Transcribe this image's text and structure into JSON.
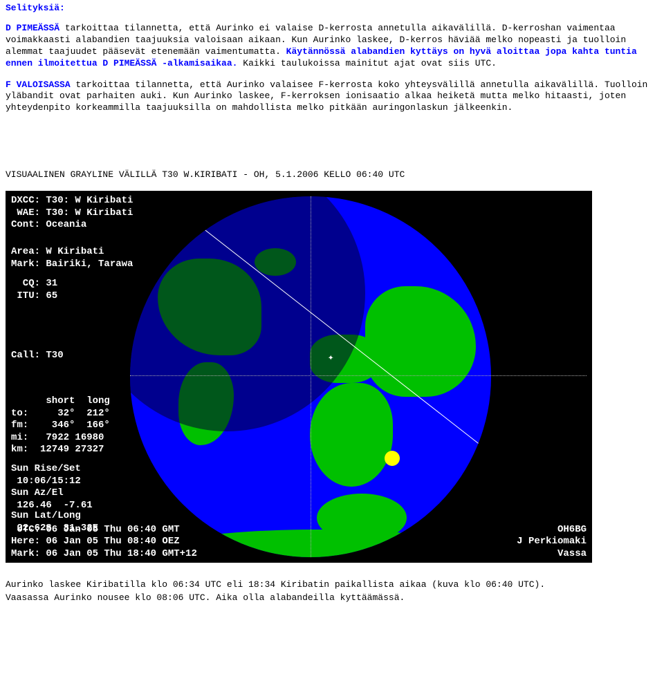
{
  "header": "Selityksiä:",
  "para1": {
    "lead": "D PIMEÄSSÄ",
    "text1": " tarkoittaa tilannetta, että Aurinko ei valaise D-kerrosta annetulla aikavälillä. D-kerroshan vaimentaa voimakkaasti alabandien taajuuksia valoisaan aikaan. Kun Aurinko laskee, D-kerros häviää melko nopeasti ja tuolloin alemmat taajuudet pääsevät etenemään vaimentumatta. ",
    "bold": "Käytännössä alabandien kyttäys on hyvä aloittaa jopa kahta tuntia ennen ilmoitettua D PIMEÄSSÄ -alkamisaikaa.",
    "text2": " Kaikki taulukoissa mainitut ajat ovat siis UTC."
  },
  "para2": {
    "lead": "F VALOISASSA",
    "text": " tarkoittaa tilannetta, että Aurinko valaisee F-kerrosta koko yhteysvälillä annetulla aikavälillä. Tuolloin yläbandit ovat parhaiten auki. Kun Aurinko laskee, F-kerroksen ionisaatio alkaa heiketä mutta melko hitaasti, joten yhteydenpito korkeammilla taajuuksilla on mahdollista melko pitkään auringonlaskun jälkeenkin."
  },
  "caption_above": "VISUAALINEN GRAYLINE VÄLILLÄ T30 W.KIRIBATI - OH, 5.1.2006 KELLO 06:40 UTC",
  "map": {
    "top": "DXCC: T30: W Kiribati\n WAE: T30: W Kiribati\nCont: Oceania",
    "area": "Area: W Kiribati\nMark: Bairiki, Tarawa",
    "cq": "  CQ: 31\n ITU: 65",
    "call": "Call: T30",
    "path": "      short  long\nto:     32°  212°\nfm:    346°  166°\nmi:   7922 16980\nkm:  12749 27327",
    "sun": "Sun Rise/Set\n 10:06/15:12\nSun Az/El\n 126.46  -7.61",
    "latlong": "Sun Lat/Long\n 22.62S  81.32E",
    "utc": " UTC: 06 Jan 05 Thu 06:40 GMT\nHere: 06 Jan 05 Thu 08:40 OEZ\nMark: 06 Jan 05 Thu 18:40 GMT+12",
    "right": "OH6BG\nJ Perkiomaki\nVassa"
  },
  "caption_below1": "Aurinko laskee Kiribatilla klo 06:34 UTC eli 18:34 Kiribatin paikallista aikaa (kuva klo 06:40 UTC).",
  "caption_below2": "Vaasassa Aurinko nousee klo 08:06 UTC. Aika olla alabandeilla kyttäämässä.",
  "chart_data": {
    "type": "map",
    "projection": "azimuthal",
    "center": {
      "call": "OH6BG",
      "qth": "Vassa"
    },
    "target": {
      "call": "T30",
      "area": "W Kiribati",
      "mark": "Bairiki, Tarawa",
      "cq": 31,
      "itu": 65
    },
    "bearings": {
      "short": {
        "to": 32,
        "from": 346
      },
      "long": {
        "to": 212,
        "from": 166
      }
    },
    "distance": {
      "mi": {
        "short": 7922,
        "long": 16980
      },
      "km": {
        "short": 12749,
        "long": 27327
      }
    },
    "sun": {
      "rise_utc": "10:06",
      "set_utc": "15:12",
      "az": 126.46,
      "el": -7.61,
      "lat": "22.62S",
      "long": "81.32E"
    },
    "times": {
      "utc": "06 Jan 05 Thu 06:40 GMT",
      "here": "06 Jan 05 Thu 08:40 OEZ",
      "mark": "06 Jan 05 Thu 18:40 GMT+12"
    }
  }
}
